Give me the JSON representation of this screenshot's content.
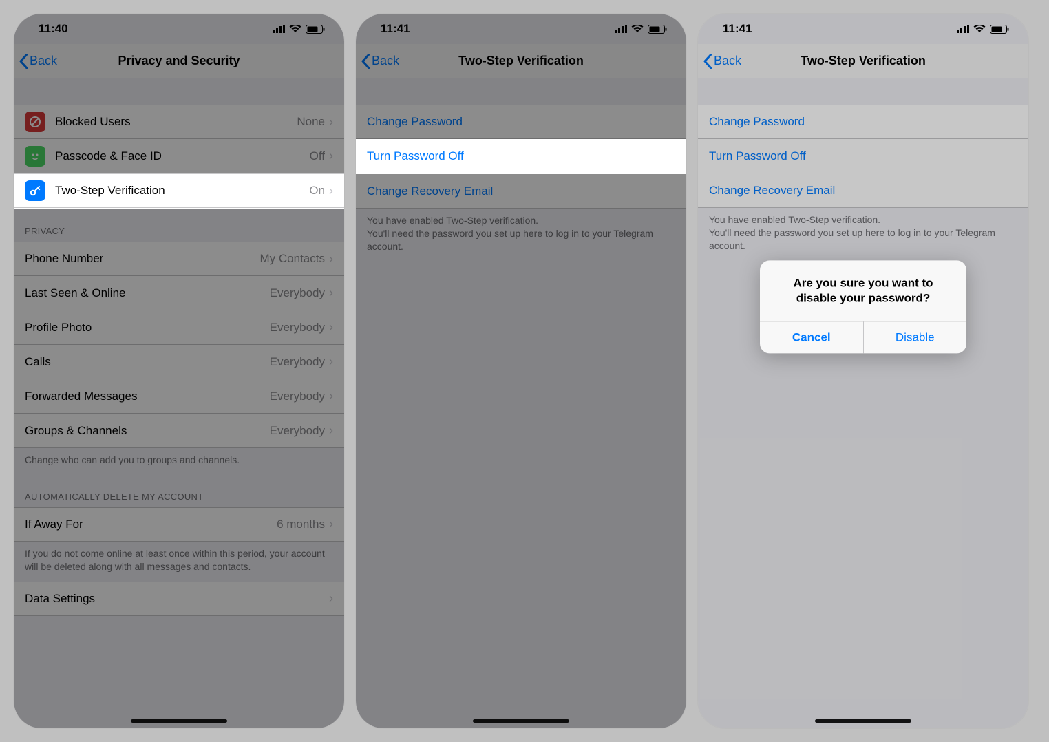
{
  "screens": [
    {
      "status_time": "11:40",
      "nav_back": "Back",
      "nav_title": "Privacy and Security",
      "security_rows": [
        {
          "icon": "blocked",
          "label": "Blocked Users",
          "value": "None"
        },
        {
          "icon": "passcode",
          "label": "Passcode & Face ID",
          "value": "Off"
        },
        {
          "icon": "twostep",
          "label": "Two-Step Verification",
          "value": "On"
        }
      ],
      "privacy_header": "PRIVACY",
      "privacy_rows": [
        {
          "label": "Phone Number",
          "value": "My Contacts"
        },
        {
          "label": "Last Seen & Online",
          "value": "Everybody"
        },
        {
          "label": "Profile Photo",
          "value": "Everybody"
        },
        {
          "label": "Calls",
          "value": "Everybody"
        },
        {
          "label": "Forwarded Messages",
          "value": "Everybody"
        },
        {
          "label": "Groups & Channels",
          "value": "Everybody"
        }
      ],
      "privacy_footer": "Change who can add you to groups and channels.",
      "delete_header": "AUTOMATICALLY DELETE MY ACCOUNT",
      "delete_row": {
        "label": "If Away For",
        "value": "6 months"
      },
      "delete_footer": "If you do not come online at least once within this period, your account will be deleted along with all messages and contacts.",
      "data_settings": "Data Settings"
    },
    {
      "status_time": "11:41",
      "nav_back": "Back",
      "nav_title": "Two-Step Verification",
      "rows": [
        {
          "label": "Change Password"
        },
        {
          "label": "Turn Password Off"
        },
        {
          "label": "Change Recovery Email"
        }
      ],
      "footer": "You have enabled Two-Step verification.\nYou'll need the password you set up here to log in to your Telegram account."
    },
    {
      "status_time": "11:41",
      "nav_back": "Back",
      "nav_title": "Two-Step Verification",
      "rows": [
        {
          "label": "Change Password"
        },
        {
          "label": "Turn Password Off"
        },
        {
          "label": "Change Recovery Email"
        }
      ],
      "footer": "You have enabled Two-Step verification.\nYou'll need the password you set up here to log in to your Telegram account.",
      "alert": {
        "message": "Are you sure you want to disable your password?",
        "cancel": "Cancel",
        "confirm": "Disable"
      }
    }
  ],
  "colors": {
    "blocked_icon_bg": "#d73a3a",
    "passcode_icon_bg": "#4cd964",
    "twostep_icon_bg": "#007aff",
    "link": "#007aff"
  }
}
